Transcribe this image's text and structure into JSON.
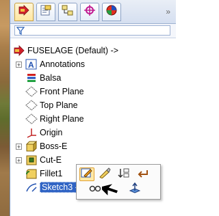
{
  "tabs": [
    {
      "name": "feature-manager"
    },
    {
      "name": "property-manager"
    },
    {
      "name": "configuration-manager"
    },
    {
      "name": "dimxpert-manager"
    },
    {
      "name": "display-manager"
    }
  ],
  "tree": {
    "root": "FUSELAGE  (Default) ->",
    "items": [
      {
        "label": "Annotations",
        "icon": "annotations-icon"
      },
      {
        "label": "Balsa",
        "icon": "material-icon"
      },
      {
        "label": "Front Plane",
        "icon": "plane-icon"
      },
      {
        "label": "Top Plane",
        "icon": "plane-icon"
      },
      {
        "label": "Right Plane",
        "icon": "plane-icon"
      },
      {
        "label": "Origin",
        "icon": "origin-icon"
      },
      {
        "label": "Boss-E",
        "icon": "boss-extrude-icon"
      },
      {
        "label": "Cut-E",
        "icon": "cut-extrude-icon"
      },
      {
        "label": "Fillet1",
        "icon": "fillet-icon"
      },
      {
        "label": "Sketch3 ->",
        "icon": "sketch-icon"
      }
    ]
  },
  "colors": {
    "selection": "#2f63c4",
    "tab_active": "#ffe6a0",
    "frame_border": "#7a96c0"
  }
}
